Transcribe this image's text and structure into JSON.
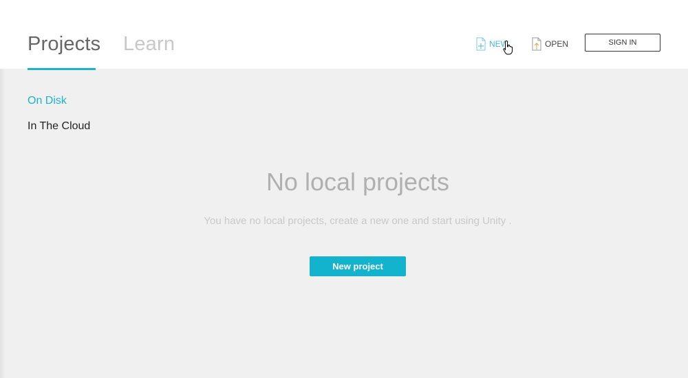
{
  "header": {
    "tabs": [
      {
        "label": "Projects",
        "active": true
      },
      {
        "label": "Learn",
        "active": false
      }
    ],
    "new_label": "NEW",
    "open_label": "OPEN",
    "sign_in_label": "SIGN IN"
  },
  "sidebar": {
    "items": [
      {
        "label": "On Disk",
        "active": true
      },
      {
        "label": "In The Cloud",
        "active": false
      }
    ]
  },
  "main": {
    "empty_title": "No local projects",
    "empty_subtitle": "You have no local projects, create a new one and start using Unity .",
    "new_project_label": "New project"
  },
  "colors": {
    "accent": "#14b3cd",
    "background": "#f0f0f0"
  }
}
